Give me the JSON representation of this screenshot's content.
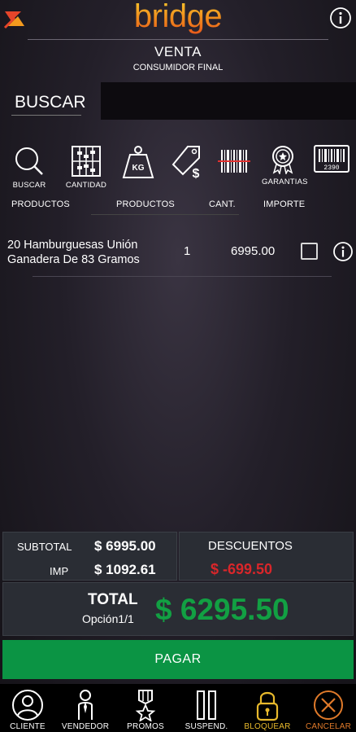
{
  "header": {
    "brand": "bridge",
    "title": "VENTA",
    "subtitle": "CONSUMIDOR FINAL"
  },
  "search": {
    "label": "BUSCAR",
    "value": ""
  },
  "toolbar": [
    {
      "label": "BUSCAR",
      "icon": "search-icon"
    },
    {
      "label": "CANTIDAD",
      "icon": "abacus-icon"
    },
    {
      "label": "",
      "icon": "weight-kg-icon"
    },
    {
      "label": "",
      "icon": "price-tag-icon"
    },
    {
      "label": "",
      "icon": "barcode-strike-icon"
    },
    {
      "label": "GARANTIAS",
      "icon": "ribbon-badge-icon"
    },
    {
      "label": "",
      "icon": "barcode-icon",
      "code": "2390"
    }
  ],
  "columns": {
    "productos1": "PRODUCTOS",
    "productos2": "PRODUCTOS",
    "cant": "CANT.",
    "importe": "IMPORTE"
  },
  "items": [
    {
      "name_line1": "20 Hamburguesas Unión",
      "name_line2": "Ganadera De 83 Gramos",
      "qty": "1",
      "importe": "6995.00",
      "checked": false
    }
  ],
  "totals": {
    "subtotal_label": "SUBTOTAL",
    "subtotal_value": "$ 6995.00",
    "imp_label": "IMP",
    "imp_value": "$ 1092.61",
    "descuentos_label": "DESCUENTOS",
    "descuentos_value": "$ -699.50",
    "total_label": "TOTAL",
    "option_label": "Opción1/1",
    "total_value": "$ 6295.50"
  },
  "pay_button": "PAGAR",
  "bottom_nav": [
    {
      "label": "CLIENTE",
      "icon": "client-icon"
    },
    {
      "label": "VENDEDOR",
      "icon": "seller-icon"
    },
    {
      "label": "PROMOS",
      "icon": "medal-icon"
    },
    {
      "label": "SUSPEND.",
      "icon": "pause-icon"
    },
    {
      "label": "BLOQUEAR",
      "icon": "lock-icon"
    },
    {
      "label": "CANCELAR",
      "icon": "cancel-icon"
    }
  ],
  "colors": {
    "brand_orange": "#f08a1c",
    "accent_yellow": "#e8b92c",
    "cancel_orange": "#e07a2a",
    "total_green": "#12a043",
    "discount_red": "#d9262a",
    "pay_green": "#0b9444"
  }
}
